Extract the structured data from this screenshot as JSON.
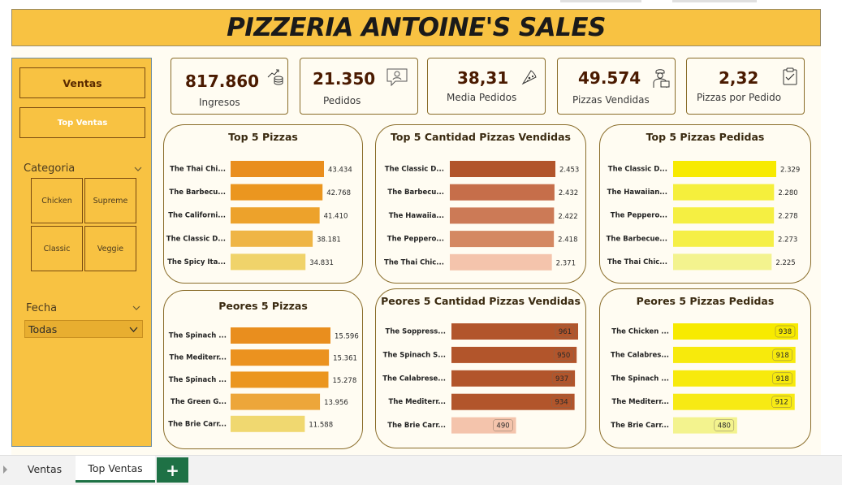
{
  "title": "PIZZERIA ANTOINE'S SALES",
  "sidebar": {
    "ventas_label": "Ventas",
    "top_ventas_label": "Top Ventas",
    "categoria_label": "Categoria",
    "categorias": [
      "Chicken",
      "Supreme",
      "Classic",
      "Veggie"
    ],
    "fecha_label": "Fecha",
    "fecha_value": "Todas"
  },
  "kpis": [
    {
      "value": "817.860",
      "label": "Ingresos",
      "icon": "coins-icon"
    },
    {
      "value": "21.350",
      "label": "Pedidos",
      "icon": "user-card-icon"
    },
    {
      "value": "38,31",
      "label": "Media Pedidos",
      "icon": "pizza-slice-icon"
    },
    {
      "value": "49.574",
      "label": "Pizzas Vendidas",
      "icon": "delivery-person-icon"
    },
    {
      "value": "2,32",
      "label": "Pizzas por Pedido",
      "icon": "clipboard-icon"
    }
  ],
  "tabs": {
    "ventas": "Ventas",
    "top_ventas": "Top Ventas",
    "add": "+"
  },
  "chart_data": [
    {
      "type": "bar",
      "title": "Top 5 Pizzas",
      "categories": [
        "The Thai Chi...",
        "The Barbecu...",
        "The Californi...",
        "The Classic D...",
        "The Spicy Ita..."
      ],
      "values": [
        43434,
        42768,
        41410,
        38181,
        34831
      ],
      "labels": [
        "43.434",
        "42.768",
        "41.410",
        "38.181",
        "34.831"
      ],
      "colors": [
        "#e98e1e",
        "#eb961f",
        "#eda22b",
        "#efb545",
        "#f0d36a"
      ],
      "xlim": [
        0,
        43434
      ],
      "label_position": "outside"
    },
    {
      "type": "bar",
      "title": "Top 5 Cantidad Pizzas Vendidas",
      "categories": [
        "The Classic D...",
        "The Barbecu...",
        "The Hawaiia...",
        "The Peppero...",
        "The Thai Chic..."
      ],
      "values": [
        2453,
        2432,
        2422,
        2418,
        2371
      ],
      "labels": [
        "2.453",
        "2.432",
        "2.422",
        "2.418",
        "2.371"
      ],
      "colors": [
        "#b2552b",
        "#c66e4a",
        "#cc7a56",
        "#d48862",
        "#f4c4ac"
      ],
      "xlim": [
        0,
        2453
      ],
      "label_position": "outside"
    },
    {
      "type": "bar",
      "title": "Top 5 Pizzas Pedidas",
      "categories": [
        "The Classic D...",
        "The Hawaiian...",
        "The Peppero...",
        "The Barbecue...",
        "The Thai Chic..."
      ],
      "values": [
        2329,
        2280,
        2278,
        2273,
        2225
      ],
      "labels": [
        "2.329",
        "2.280",
        "2.278",
        "2.273",
        "2.225"
      ],
      "colors": [
        "#f7ea00",
        "#f5ef3c",
        "#f5ef42",
        "#f5ef46",
        "#f3f38e"
      ],
      "xlim": [
        0,
        2329
      ],
      "label_position": "outside"
    },
    {
      "type": "bar",
      "title": "Peores 5 Pizzas",
      "categories": [
        "The Spinach ...",
        "The Mediterr...",
        "The Spinach ...",
        "The Green G...",
        "The Brie Carr..."
      ],
      "values": [
        15596,
        15361,
        15278,
        13956,
        11588
      ],
      "labels": [
        "15.596",
        "15.361",
        "15.278",
        "13.956",
        "11.588"
      ],
      "colors": [
        "#e98e1e",
        "#eb921f",
        "#eb961f",
        "#eda63a",
        "#f0d870"
      ],
      "xlim": [
        0,
        15596
      ],
      "label_position": "outside"
    },
    {
      "type": "bar",
      "title": "Peores 5 Cantidad Pizzas Vendidas",
      "categories": [
        "The Soppress...",
        "The Spinach S...",
        "The Calabrese...",
        "The Mediterr...",
        "The Brie Carr..."
      ],
      "values": [
        961,
        950,
        937,
        934,
        490
      ],
      "labels": [
        "961",
        "950",
        "937",
        "934",
        "490"
      ],
      "colors": [
        "#b2552b",
        "#b2552b",
        "#b2552b",
        "#b2552b",
        "#f4c4ac"
      ],
      "xlim": [
        0,
        961
      ],
      "label_position": "inside"
    },
    {
      "type": "bar",
      "title": "Peores 5 Pizzas Pedidas",
      "categories": [
        "The Chicken ...",
        "The Calabres...",
        "The Spinach ...",
        "The Mediterr...",
        "The Brie Carr..."
      ],
      "values": [
        938,
        918,
        918,
        912,
        480
      ],
      "labels": [
        "938",
        "918",
        "918",
        "912",
        "480"
      ],
      "colors": [
        "#f7ea00",
        "#f7ea0c",
        "#f7ea0c",
        "#f7ea14",
        "#f3f38e"
      ],
      "xlim": [
        0,
        938
      ],
      "label_position": "inside"
    }
  ]
}
